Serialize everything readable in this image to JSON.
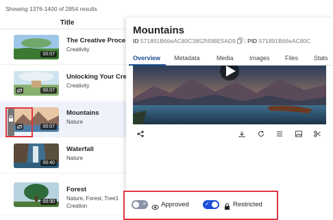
{
  "list": {
    "results_count": "Showing 1376-1400 of 2854 results",
    "column_title": "Title",
    "rows": [
      {
        "title": "The Creative Proces",
        "subtitle": "Creativity",
        "duration": "00:07"
      },
      {
        "title": "Unlocking Your Crea",
        "subtitle": "Creativity",
        "duration": "00:07"
      },
      {
        "title": "Mountains",
        "subtitle": "Nature",
        "duration": "00:07"
      },
      {
        "title": "Waterfall",
        "subtitle": "Nature",
        "duration": "00:40"
      },
      {
        "title": "Forest",
        "subtitle": "Nature, Forest, Tree1",
        "subtitle2": "Creation",
        "duration": "00:30"
      }
    ]
  },
  "panel": {
    "title": "Mountains",
    "id_label": "ID",
    "id_value": "571891B66eAC80C3852f49BE5AD9",
    "pid_label": "PID",
    "pid_value": "571891B66eAC80C",
    "tabs": [
      "Overview",
      "Metadata",
      "Media",
      "Images",
      "Files",
      "Stats"
    ],
    "active_tab": "Overview"
  },
  "toggles": {
    "approved_label": "Approved",
    "approved_state": "off",
    "restricted_label": "Restricted",
    "restricted_state": "on"
  },
  "icons": [
    "share-icon",
    "download-icon",
    "refresh-icon",
    "list-icon",
    "image-icon",
    "scissors-icon",
    "copy-icon",
    "eye-icon",
    "lock-icon",
    "visibility-off-icon"
  ],
  "colors": {
    "accent": "#1d4e91",
    "toggle_on": "#1d4ed8",
    "highlight_box": "#e0343f"
  }
}
